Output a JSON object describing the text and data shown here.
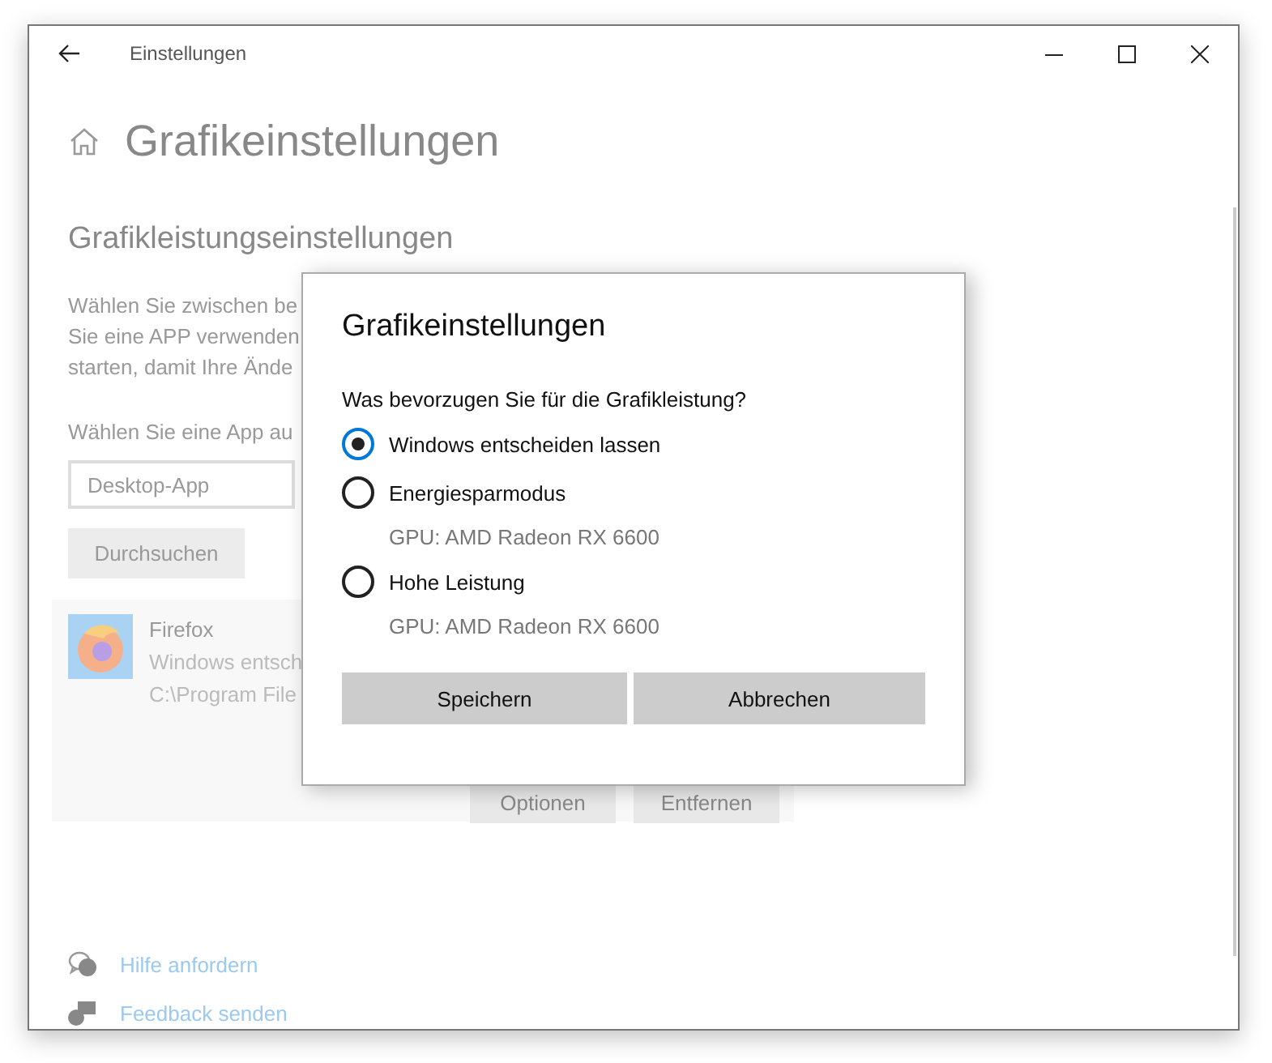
{
  "window": {
    "title": "Einstellungen"
  },
  "page": {
    "title": "Grafikeinstellungen",
    "section": "Grafikleistungseinstellungen",
    "description_lines": [
      "Wählen Sie zwischen be",
      "Sie eine APP verwenden",
      "starten, damit Ihre Ände"
    ],
    "app_prompt": "Wählen Sie eine App au",
    "app_type": {
      "value": "Desktop-App"
    },
    "browse_button": "Durchsuchen",
    "apps": [
      {
        "name": "Firefox",
        "preference": "Windows entsch",
        "path": "C:\\Program File",
        "buttons": [
          "Optionen",
          "Entfernen"
        ]
      }
    ]
  },
  "links": [
    {
      "label": "Hilfe anfordern",
      "kind": "help"
    },
    {
      "label": "Feedback senden",
      "kind": "feedback"
    }
  ],
  "dialog": {
    "title": "Grafikeinstellungen",
    "question": "Was bevorzugen Sie für die Grafikleistung?",
    "options": [
      {
        "label": "Windows entscheiden lassen",
        "selected": true
      },
      {
        "label": "Energiesparmodus",
        "detail": "GPU: AMD Radeon RX 6600",
        "selected": false
      },
      {
        "label": "Hohe Leistung",
        "detail": "GPU: AMD Radeon RX 6600",
        "selected": false
      }
    ],
    "buttons": [
      "Speichern",
      "Abbrechen"
    ]
  }
}
